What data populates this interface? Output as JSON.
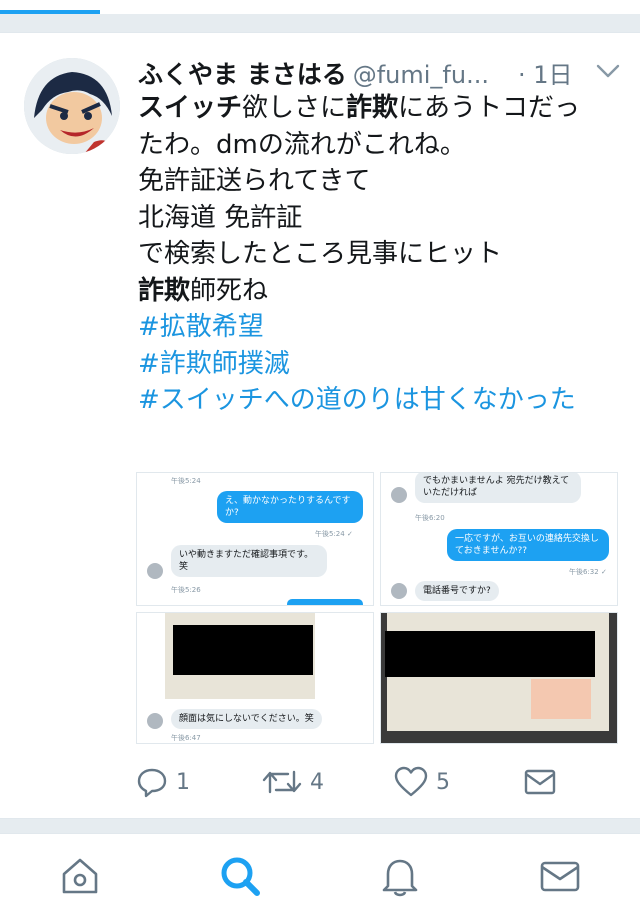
{
  "tweet": {
    "author_name": "ふくやま まさはる",
    "handle": "@fumi_fu...",
    "time": "· 1日",
    "lines": [
      [
        {
          "t": "スイッチ",
          "b": true
        },
        {
          "t": "欲しさに"
        },
        {
          "t": "詐欺",
          "b": true
        },
        {
          "t": "にあうトコだっ"
        }
      ],
      [
        {
          "t": "たわ。dmの流れがこれね。"
        }
      ],
      [
        {
          "t": "免許証送られてきて"
        }
      ],
      [
        {
          "t": "北海道 免許証"
        }
      ],
      [
        {
          "t": "で検索したところ見事にヒット"
        }
      ],
      [
        {
          "t": "詐欺",
          "b": true
        },
        {
          "t": "師死ね"
        }
      ],
      [
        {
          "t": " "
        }
      ],
      [
        {
          "t": "#拡散希望",
          "tag": true
        }
      ],
      [
        {
          "t": "#詐欺師撲滅",
          "tag": true
        }
      ],
      [
        {
          "t": "#スイッチへの道のりは甘くなかった",
          "tag": true
        }
      ]
    ]
  },
  "media": {
    "tl": {
      "ts_top": "午後5:24",
      "bubble1": "え、動かなかったりするんですか?",
      "ts1": "午後5:24 ✓",
      "bubble2": "いや動きますただ確認事項です。笑",
      "ts2": "午後5:26"
    },
    "tr": {
      "bubble1": "でもかまいませんよ 宛先だけ教えていただければ",
      "ts1": "午後6:20",
      "bubble2": "一応ですが、お互いの連絡先交換しておきませんか??",
      "ts2": "午後6:32 ✓",
      "bubble3": "電話番号ですか?"
    },
    "bl": {
      "bubble1": "顔面は気にしないでください。笑",
      "ts1": "午後6:47"
    }
  },
  "actions": {
    "reply_count": "1",
    "retweet_count": "4",
    "like_count": "5"
  },
  "colors": {
    "accent": "#1da1f2",
    "hashtag": "#1b95e0",
    "muted": "#657786"
  },
  "icons": {
    "reply": "reply-icon",
    "retweet": "retweet-icon",
    "like": "heart-icon",
    "dm": "envelope-icon",
    "home": "home-icon",
    "search": "search-icon",
    "notifications": "bell-icon",
    "messages": "mail-icon"
  }
}
